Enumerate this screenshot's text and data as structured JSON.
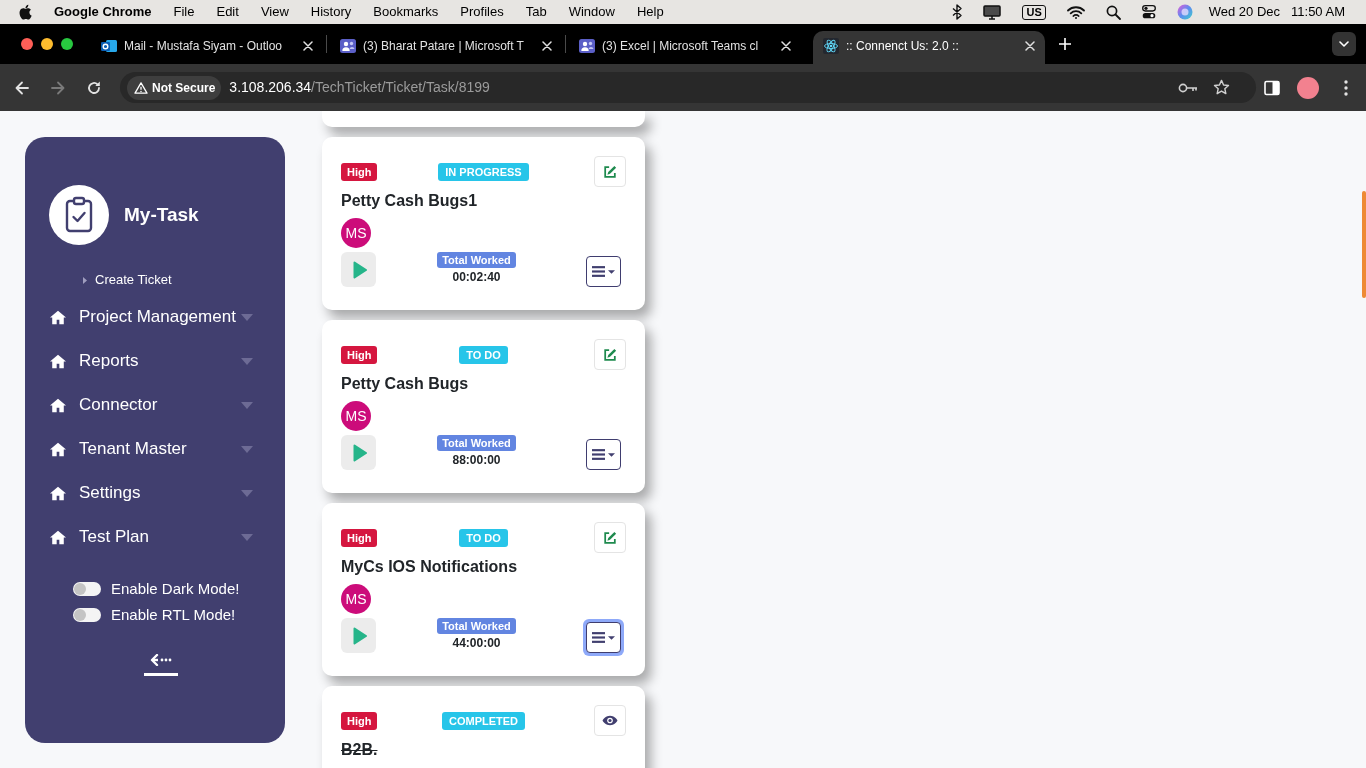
{
  "menu_bar": {
    "app_name": "Google Chrome",
    "menus": [
      "File",
      "Edit",
      "View",
      "History",
      "Bookmarks",
      "Profiles",
      "Tab",
      "Window",
      "Help"
    ],
    "input_source": "US",
    "date": "Wed 20 Dec",
    "time": "11:50 AM"
  },
  "browser": {
    "tabs": [
      {
        "kind": "mail",
        "title": "Mail - Mustafa Siyam - Outloo",
        "selected": false
      },
      {
        "kind": "chat",
        "title": "(3) Bharat Patare | Microsoft T",
        "selected": false
      },
      {
        "kind": "chat",
        "title": "(3) Excel | Microsoft Teams cl",
        "selected": false
      },
      {
        "kind": "atom",
        "title": ":: Connenct Us: 2.0 ::",
        "selected": true
      }
    ],
    "forward_disabled": true,
    "security": "Not Secure",
    "url_host": "3.108.206.34",
    "url_path": "/TechTicket/Ticket/Task/8199"
  },
  "sidebar": {
    "title": "My-Task",
    "links": [
      "Create Ticket"
    ],
    "items": [
      "Project Management",
      "Reports",
      "Connector",
      "Tenant Master",
      "Settings",
      "Test Plan"
    ],
    "toggles": [
      {
        "label": "Enable Dark Mode!",
        "on": false
      },
      {
        "label": "Enable RTL Mode!",
        "on": false
      }
    ]
  },
  "cards": [
    {
      "priority": "High",
      "status": "IN PROGRESS",
      "title": "Petty Cash Bugs1",
      "assignee": "MS",
      "total_label": "Total Worked",
      "total": "00:02:40",
      "completed": false,
      "menu_focused": false
    },
    {
      "priority": "High",
      "status": "TO DO",
      "title": "Petty Cash Bugs",
      "assignee": "MS",
      "total_label": "Total Worked",
      "total": "88:00:00",
      "completed": false,
      "menu_focused": false
    },
    {
      "priority": "High",
      "status": "TO DO",
      "title": "MyCs IOS Notifications",
      "assignee": "MS",
      "total_label": "Total Worked",
      "total": "44:00:00",
      "completed": false,
      "menu_focused": true
    },
    {
      "priority": "High",
      "status": "COMPLETED",
      "title": "B2B.",
      "completed": true
    }
  ]
}
